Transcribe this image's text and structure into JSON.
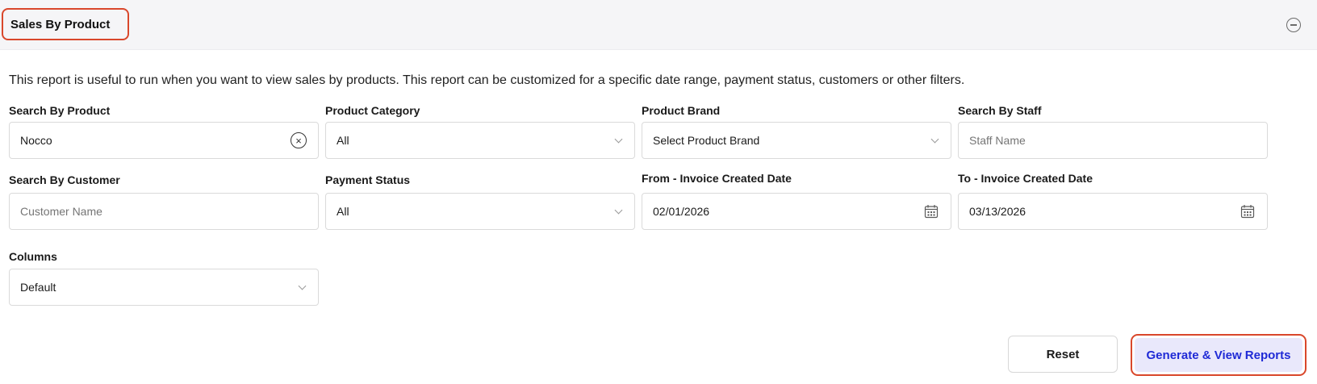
{
  "header": {
    "title": "Sales By Product"
  },
  "description": "This report is useful to run when you want to view sales by products. This report can be customized for a specific date range, payment status, customers or other filters.",
  "filters": {
    "product": {
      "label": "Search By Product",
      "value": "Nocco"
    },
    "category": {
      "label": "Product Category",
      "value": "All"
    },
    "brand": {
      "label": "Product Brand",
      "value": "Select Product Brand"
    },
    "staff": {
      "label": "Search By Staff",
      "placeholder": "Staff Name"
    },
    "customer": {
      "label": "Search By Customer",
      "placeholder": "Customer Name"
    },
    "payment_status": {
      "label": "Payment Status",
      "value": "All"
    },
    "from_date": {
      "label": "From - Invoice Created Date",
      "value": "02/01/2026"
    },
    "to_date": {
      "label": "To - Invoice Created Date",
      "value": "03/13/2026"
    },
    "columns": {
      "label": "Columns",
      "value": "Default"
    }
  },
  "actions": {
    "reset_label": "Reset",
    "generate_label": "Generate & View Reports"
  },
  "colors": {
    "highlight": "#d9472b",
    "primary_text": "#1f2ad6",
    "primary_bg": "#e9e8fb"
  }
}
